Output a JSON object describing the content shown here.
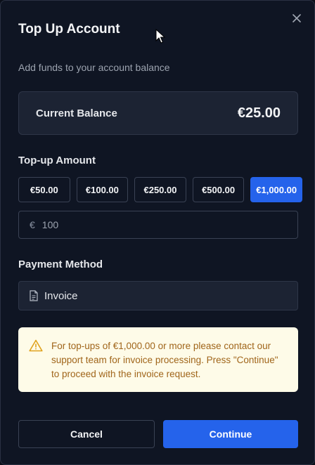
{
  "dialog": {
    "title": "Top Up Account",
    "subtitle": "Add funds to your account balance",
    "close_icon": "close-icon"
  },
  "balance": {
    "label": "Current Balance",
    "value": "€25.00"
  },
  "topup": {
    "label": "Top-up Amount",
    "options": [
      "€50.00",
      "€100.00",
      "€250.00",
      "€500.00",
      "€1,000.00"
    ],
    "selected_index": 4,
    "currency_symbol": "€",
    "input_value": "100"
  },
  "payment": {
    "label": "Payment Method",
    "selected": "Invoice",
    "icon": "document-icon"
  },
  "warning": {
    "icon": "warning-icon",
    "text": "For top-ups of €1,000.00 or more please contact our support team for invoice processing. Press \"Continue\" to proceed with the invoice request."
  },
  "actions": {
    "cancel": "Cancel",
    "continue": "Continue"
  },
  "colors": {
    "accent": "#2563eb",
    "warning_bg": "#fefbe8",
    "warning_text": "#a0651a"
  }
}
